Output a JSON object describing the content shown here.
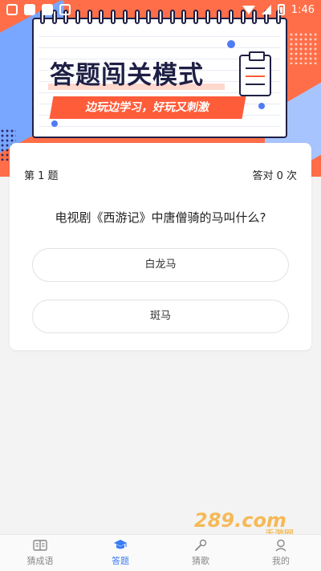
{
  "status_bar": {
    "time": "1:46"
  },
  "hero": {
    "title": "答题闯关模式",
    "slogan": "边玩边学习，好玩又刺激"
  },
  "quiz": {
    "question_number": "第 1 题",
    "correct_count": "答对 0 次",
    "question": "电视剧《西游记》中唐僧骑的马叫什么?",
    "options": [
      "白龙马",
      "斑马"
    ]
  },
  "watermark": {
    "text": "289.com",
    "subtext": "手游网"
  },
  "tabs": [
    {
      "label": "猜成语",
      "icon": "book-icon"
    },
    {
      "label": "答题",
      "icon": "graduation-cap-icon"
    },
    {
      "label": "猜歌",
      "icon": "microphone-icon"
    },
    {
      "label": "我的",
      "icon": "user-icon"
    }
  ],
  "active_tab": "答题",
  "colors": {
    "hero_orange": "#ff6e48",
    "accent_red": "#ff5c3a",
    "accent_blue": "#3a7cf5",
    "navy": "#1f1f45"
  }
}
